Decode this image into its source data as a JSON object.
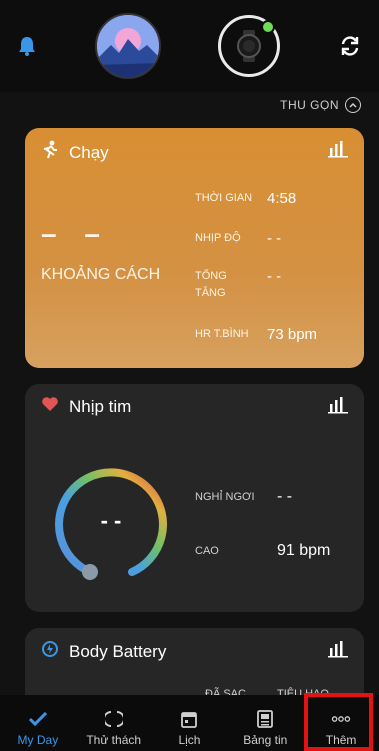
{
  "header": {
    "collapse_label": "THU GỌN"
  },
  "run_card": {
    "title": "Chạy",
    "distance_value": "– –",
    "distance_label": "KHOẢNG CÁCH",
    "stats": [
      {
        "label": "THỜI GIAN",
        "value": "4:58"
      },
      {
        "label": "NHỊP ĐỘ",
        "value": "- -"
      },
      {
        "label": "TỔNG TĂNG",
        "value": "- -"
      },
      {
        "label": "HR T.BÌNH",
        "value": "73 bpm"
      }
    ]
  },
  "heart_card": {
    "title": "Nhịp tim",
    "center_value": "- -",
    "stats": [
      {
        "label": "NGHỈ NGƠI",
        "value": "- -"
      },
      {
        "label": "CAO",
        "value": "91 bpm"
      }
    ]
  },
  "battery_card": {
    "title": "Body Battery",
    "charged_label": "ĐÃ SẠC",
    "drained_label": "TIÊU HAO"
  },
  "nav": {
    "items": [
      {
        "label": "My Day",
        "icon": "check-icon"
      },
      {
        "label": "Thử thách",
        "icon": "laurel-icon"
      },
      {
        "label": "Lịch",
        "icon": "calendar-icon"
      },
      {
        "label": "Bảng tin",
        "icon": "news-icon"
      },
      {
        "label": "Thêm",
        "icon": "more-icon"
      }
    ]
  },
  "colors": {
    "accent": "#3a97e8",
    "run_card": "#d88f33",
    "card_bg": "#262626",
    "highlight": "#e41313"
  }
}
